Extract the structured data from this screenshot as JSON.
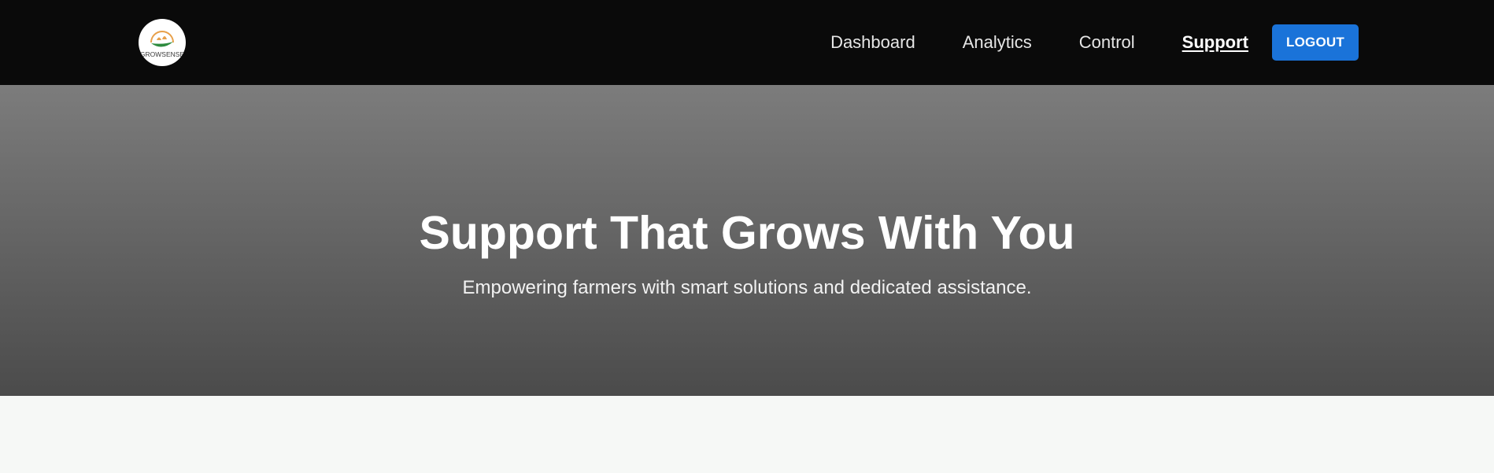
{
  "brand": {
    "logo_text": "GROWSENSE",
    "logo_icon": "leaf-logo-icon"
  },
  "nav": {
    "items": [
      {
        "label": "Dashboard",
        "active": false
      },
      {
        "label": "Analytics",
        "active": false
      },
      {
        "label": "Control",
        "active": false
      },
      {
        "label": "Support",
        "active": true
      }
    ],
    "logout_label": "LOGOUT"
  },
  "hero": {
    "title": "Support That Grows With You",
    "subtitle": "Empowering farmers with smart solutions and dedicated assistance."
  },
  "colors": {
    "navbar_bg": "#0a0a0a",
    "accent": "#1a73d9",
    "hero_top": "#7c7c7c",
    "hero_bottom": "#4b4b4b",
    "page_bg": "#f6f8f6"
  }
}
